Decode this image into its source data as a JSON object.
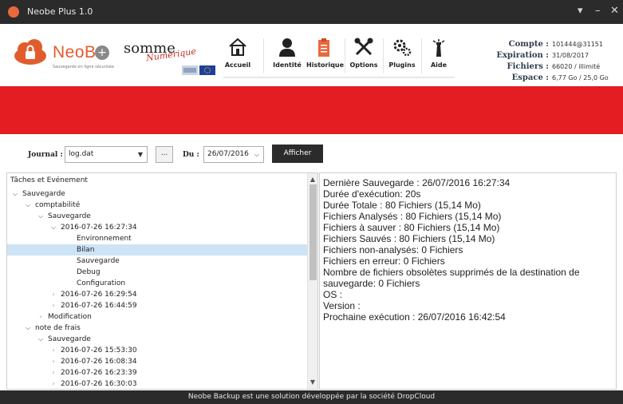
{
  "window": {
    "title": "Neobe Plus 1.0",
    "controls": {
      "menu": "▾",
      "minimize": "–",
      "close": "✕"
    }
  },
  "header": {
    "brand_name": "NeoBe",
    "brand_plus": "+",
    "brand_tagline": "Sauvegarde en ligne sécurisée",
    "partner_name": "somme",
    "partner_script": "Numérique",
    "nav": [
      {
        "label": "Accueil",
        "icon": "home-icon"
      },
      {
        "label": "Identité",
        "icon": "user-icon"
      },
      {
        "label": "Historique",
        "icon": "clipboard-icon"
      },
      {
        "label": "Options",
        "icon": "tools-icon"
      },
      {
        "label": "Plugins",
        "icon": "gears-icon"
      },
      {
        "label": "Aide",
        "icon": "lighthouse-icon"
      }
    ],
    "account": [
      {
        "key": "Compte :",
        "value": "101444@31151"
      },
      {
        "key": "Expiration :",
        "value": "31/08/2017"
      },
      {
        "key": "Fichiers :",
        "value": "66020 / illimité"
      },
      {
        "key": "Espace :",
        "value": "6,77 Go / 25,0 Go"
      }
    ]
  },
  "colors": {
    "accent": "#e41d23",
    "brand": "#e15c2d",
    "dark": "#2b2b2b",
    "selection": "#cde4f7"
  },
  "toolbar": {
    "journal_label": "Journal :",
    "journal_value": "log.dat",
    "browse_label": "...",
    "du_label": "Du :",
    "date_value": "26/07/2016",
    "afficher_label": "Afficher"
  },
  "tree": {
    "header": "Tâches et Evénement",
    "rows": [
      {
        "text": "Sauvegarde",
        "toggle": "open",
        "depth": 0
      },
      {
        "text": "comptabilité",
        "toggle": "open",
        "depth": 1
      },
      {
        "text": "Sauvegarde",
        "toggle": "open",
        "depth": 2
      },
      {
        "text": "2016-07-26  16:27:34",
        "toggle": "open",
        "depth": 3
      },
      {
        "text": "Environnement",
        "toggle": "none",
        "depth": 4
      },
      {
        "text": "Bilan",
        "toggle": "none",
        "depth": 4,
        "selected": true
      },
      {
        "text": "Sauvegarde",
        "toggle": "none",
        "depth": 4
      },
      {
        "text": "Debug",
        "toggle": "none",
        "depth": 4
      },
      {
        "text": "Configuration",
        "toggle": "none",
        "depth": 4
      },
      {
        "text": "2016-07-26  16:29:54",
        "toggle": "closed",
        "depth": 3
      },
      {
        "text": "2016-07-26  16:44:59",
        "toggle": "closed",
        "depth": 3
      },
      {
        "text": "Modification",
        "toggle": "closed",
        "depth": 2
      },
      {
        "text": "note de frais",
        "toggle": "open",
        "depth": 1
      },
      {
        "text": "Sauvegarde",
        "toggle": "open",
        "depth": 2
      },
      {
        "text": "2016-07-26  15:53:30",
        "toggle": "closed",
        "depth": 3
      },
      {
        "text": "2016-07-26  16:08:34",
        "toggle": "closed",
        "depth": 3
      },
      {
        "text": "2016-07-26  16:23:39",
        "toggle": "closed",
        "depth": 3
      },
      {
        "text": "2016-07-26  16:30:03",
        "toggle": "closed",
        "depth": 3
      }
    ]
  },
  "details": [
    "Dernière Sauvegarde : 26/07/2016 16:27:34",
    "Durée d'exécution: 20s",
    "Durée Totale : 80 Fichiers (15,14 Mo)",
    "Fichiers Analysés : 80 Fichiers (15,14 Mo)",
    "Fichiers à sauver : 80 Fichiers (15,14 Mo)",
    "Fichiers Sauvés : 80 Fichiers (15,14 Mo)",
    "Fichiers non-analysés:  0 Fichiers",
    "Fichiers en erreur:  0 Fichiers",
    "Nombre de fichiers obsolètes supprimés de la destination de",
    "sauvegarde:  0 Fichiers",
    "OS :",
    "Version :",
    "Prochaine exécution : 26/07/2016 16:42:54"
  ],
  "status": {
    "text": "Neobe Backup est une solution développée par la société DropCloud"
  }
}
